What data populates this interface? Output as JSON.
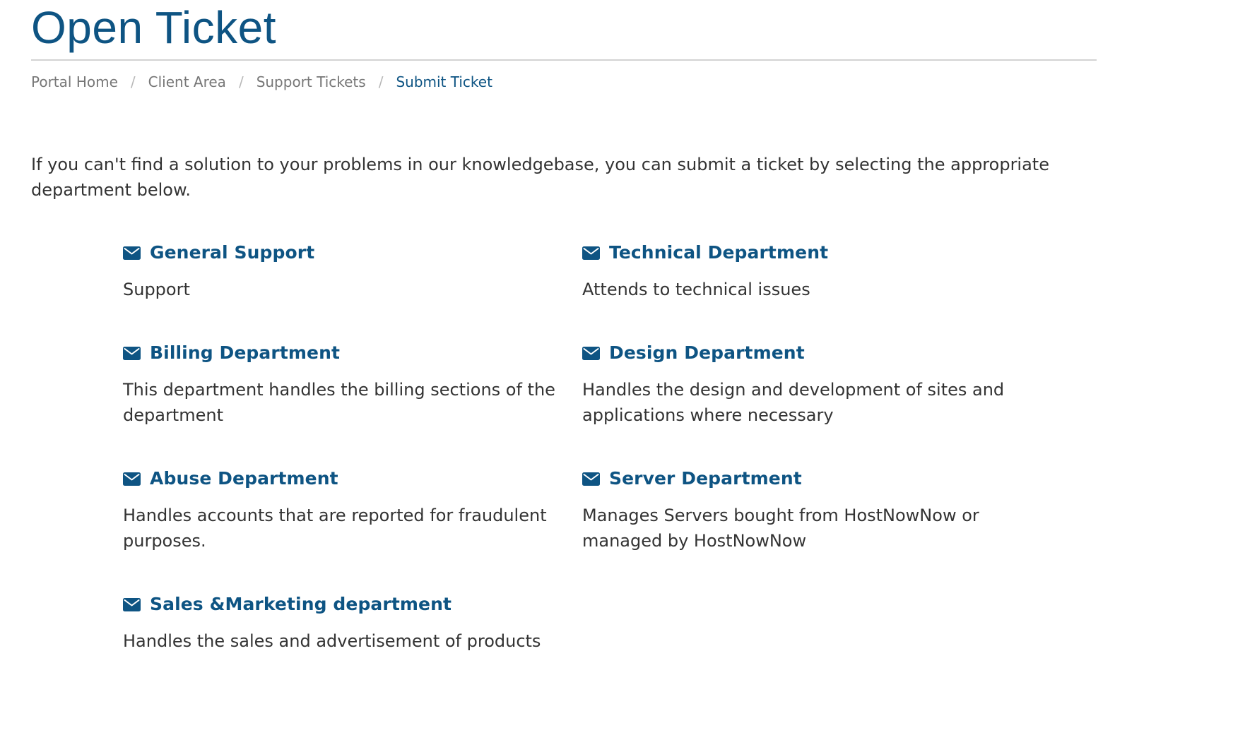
{
  "page": {
    "title": "Open Ticket"
  },
  "breadcrumb": {
    "items": [
      {
        "label": "Portal Home"
      },
      {
        "label": "Client Area"
      },
      {
        "label": "Support Tickets"
      },
      {
        "label": "Submit Ticket"
      }
    ],
    "separator": "/"
  },
  "intro": {
    "text": "If you can't find a solution to your problems in our knowledgebase, you can submit a ticket by selecting the appropriate department below."
  },
  "departments": [
    {
      "name": "General Support",
      "description": "Support",
      "icon": "envelope-icon"
    },
    {
      "name": "Technical Department",
      "description": "Attends to technical issues",
      "icon": "envelope-icon"
    },
    {
      "name": "Billing Department",
      "description": "This department handles the billing sections of the department",
      "icon": "envelope-icon"
    },
    {
      "name": "Design Department",
      "description": "Handles the design and development of sites and applications where necessary",
      "icon": "envelope-icon"
    },
    {
      "name": "Abuse Department",
      "description": "Handles accounts that are reported for fraudulent purposes.",
      "icon": "envelope-icon"
    },
    {
      "name": "Server Department",
      "description": "Manages Servers bought from HostNowNow or managed by HostNowNow",
      "icon": "envelope-icon"
    },
    {
      "name": "Sales &Marketing department",
      "description": "Handles the sales and advertisement of products",
      "icon": "envelope-icon"
    }
  ],
  "colors": {
    "brand": "#0e5483",
    "text": "#333333",
    "muted": "#777777"
  }
}
